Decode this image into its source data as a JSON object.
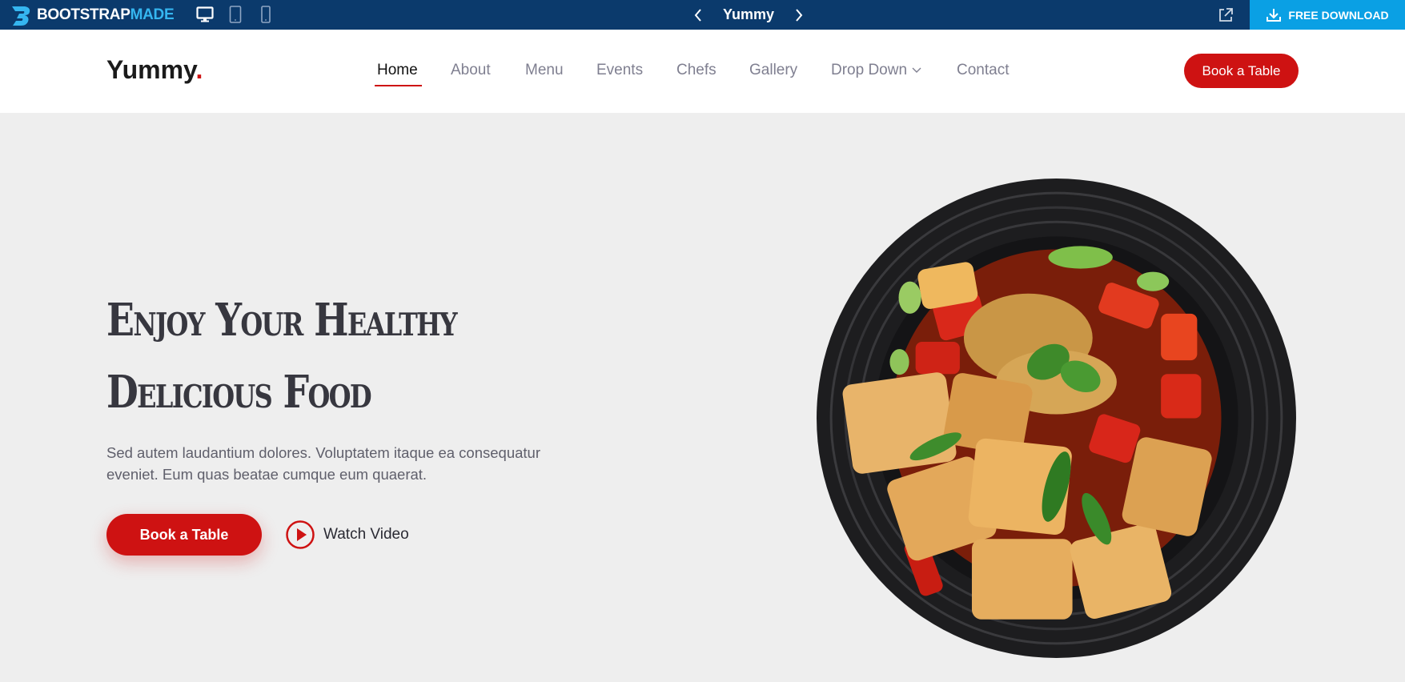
{
  "preview_bar": {
    "brand_part1": "BOOTSTRAP",
    "brand_part2": "MADE",
    "template_name": "Yummy",
    "download_label": "FREE DOWNLOAD"
  },
  "header": {
    "logo": "Yummy",
    "logo_dot": ".",
    "nav": [
      {
        "label": "Home"
      },
      {
        "label": "About"
      },
      {
        "label": "Menu"
      },
      {
        "label": "Events"
      },
      {
        "label": "Chefs"
      },
      {
        "label": "Gallery"
      },
      {
        "label": "Drop Down"
      },
      {
        "label": "Contact"
      }
    ],
    "book_label": "Book a Table"
  },
  "hero": {
    "title_line1": "Enjoy Your Healthy",
    "title_line2": "Delicious Food",
    "description": "Sed autem laudantium dolores. Voluptatem itaque ea consequatur eveniet. Eum quas beatae cumque eum quaerat.",
    "book_label": "Book a Table",
    "watch_label": "Watch Video"
  },
  "colors": {
    "accent": "#ce1212",
    "preview_bar": "#0b3a6c",
    "download": "#0aa0e4",
    "hero_bg": "#eeeeee"
  },
  "icons": [
    "bootstrapmade-logo-icon",
    "desktop-icon",
    "tablet-icon",
    "mobile-icon",
    "chevron-left-icon",
    "chevron-right-icon",
    "external-link-icon",
    "download-icon",
    "chevron-down-icon",
    "play-icon"
  ]
}
